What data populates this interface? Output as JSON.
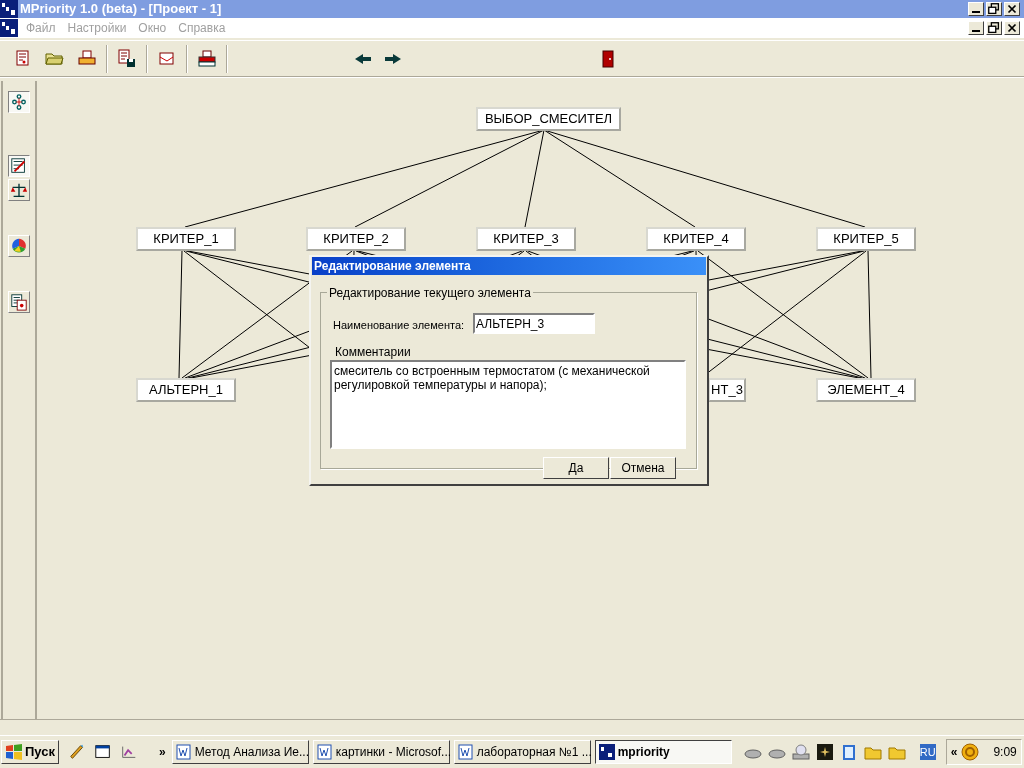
{
  "window": {
    "title": "MPriority 1.0 (beta) - [Проект - 1]"
  },
  "menu": [
    {
      "label": "Файл",
      "disabled": true
    },
    {
      "label": "Настройки",
      "disabled": true
    },
    {
      "label": "Окно",
      "disabled": true
    },
    {
      "label": "Справка",
      "disabled": true
    }
  ],
  "side_tools": [
    {
      "selected": true
    },
    {
      "selected": true
    },
    {
      "selected": false
    },
    {
      "selected": false
    },
    {
      "selected": false
    }
  ],
  "diagram": {
    "goal": "ВЫБОР_СМЕСИТЕЛ",
    "criteria": [
      "КРИТЕР_1",
      "КРИТЕР_2",
      "КРИТЕР_3",
      "КРИТЕР_4",
      "КРИТЕР_5"
    ],
    "alternatives": [
      "АЛЬТЕРН_1",
      "НТ_3",
      "ЭЛЕМЕНТ_4"
    ]
  },
  "dialog": {
    "title": "Редактирование элемента",
    "group": "Редактирование текущего элемента",
    "name_label": "Наименование элемента:",
    "name_value": "АЛЬТЕРН_3",
    "comment_label": "Комментарии",
    "comment": "смеситель со встроенным термостатом (с механической регулировкой температуры и напора);",
    "buttons": [
      "Да",
      "Отмена"
    ]
  },
  "taskbar": {
    "start": "Пуск",
    "chevron": "»",
    "tasks": [
      {
        "label": "Метод Анализа Ие...",
        "selected": false
      },
      {
        "label": "картинки - Microsof...",
        "selected": false
      },
      {
        "label": "лабораторная №1 ...",
        "selected": false
      },
      {
        "label": "mpriority",
        "selected": true
      }
    ],
    "language": "RU",
    "tray_chevron": "«",
    "clock": "9:09"
  }
}
